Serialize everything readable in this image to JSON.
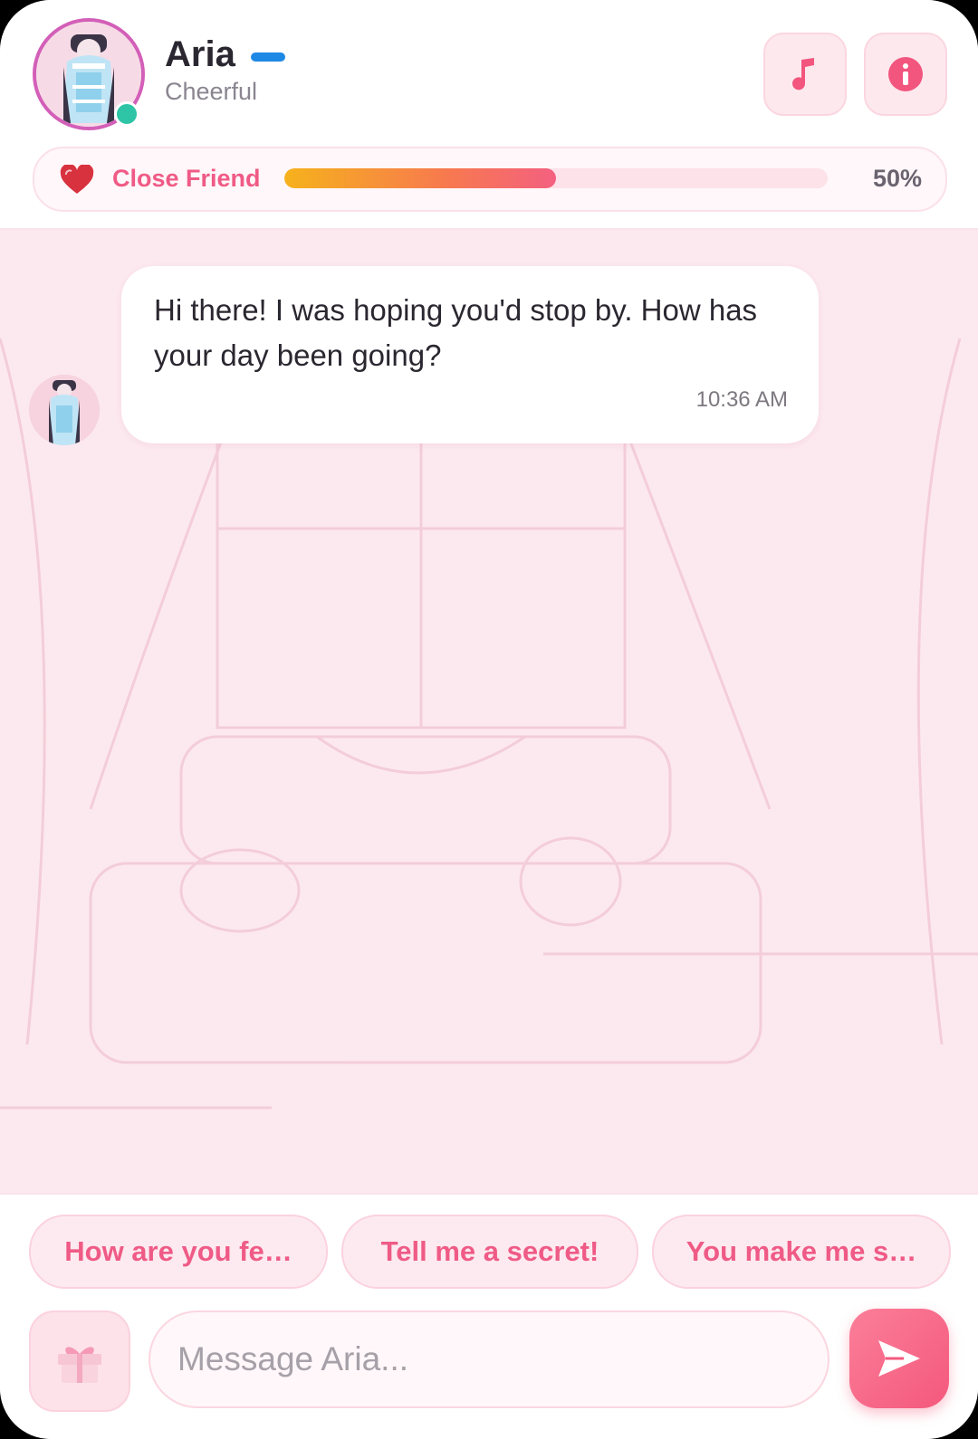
{
  "header": {
    "name": "Aria",
    "mood": "Cheerful",
    "online_status_color": "#2ec4a6",
    "avatar_icon": "character-avatar",
    "music_icon": "music-note-icon",
    "info_icon": "info-icon"
  },
  "relationship": {
    "label": "Close Friend",
    "percent_text": "50%",
    "progress": 0.5,
    "icon": "heart-icon"
  },
  "chat": {
    "messages": [
      {
        "sender": "Aria",
        "text": "Hi there! I was hoping you'd stop by. How has your day been going?",
        "time": "10:36 AM"
      }
    ]
  },
  "quick_replies": [
    {
      "label": "How are you fe…"
    },
    {
      "label": "Tell me a secret!"
    },
    {
      "label": "You make me s…"
    }
  ],
  "composer": {
    "placeholder": "Message Aria...",
    "gift_icon": "gift-icon",
    "send_icon": "send-icon"
  },
  "colors": {
    "accent": "#ef5b86",
    "send_button": "#f4587c",
    "chat_background": "#fce9ef"
  }
}
